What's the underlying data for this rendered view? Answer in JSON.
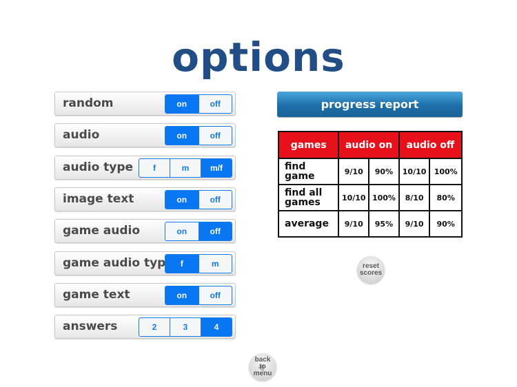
{
  "title": "options",
  "options": [
    {
      "label": "random",
      "choices": [
        "on",
        "off"
      ],
      "selected": "on"
    },
    {
      "label": "audio",
      "choices": [
        "on",
        "off"
      ],
      "selected": "on"
    },
    {
      "label": "audio type",
      "choices": [
        "f",
        "m",
        "m/f"
      ],
      "selected": "m/f"
    },
    {
      "label": "image text",
      "choices": [
        "on",
        "off"
      ],
      "selected": "on"
    },
    {
      "label": "game audio",
      "choices": [
        "on",
        "off"
      ],
      "selected": "off"
    },
    {
      "label": "game audio type",
      "choices": [
        "f",
        "m"
      ],
      "selected": "f"
    },
    {
      "label": "game text",
      "choices": [
        "on",
        "off"
      ],
      "selected": "on"
    },
    {
      "label": "answers",
      "choices": [
        "2",
        "3",
        "4"
      ],
      "selected": "4"
    }
  ],
  "progress_report": {
    "button_label": "progress report",
    "headers": [
      "games",
      "audio on",
      "audio off"
    ],
    "rows": [
      {
        "label": "find game",
        "audio_on_score": "9/10",
        "audio_on_pct": "90%",
        "audio_off_score": "10/10",
        "audio_off_pct": "100%"
      },
      {
        "label": "find  all games",
        "audio_on_score": "10/10",
        "audio_on_pct": "100%",
        "audio_off_score": "8/10",
        "audio_off_pct": "80%"
      },
      {
        "label": "average",
        "audio_on_score": "9/10",
        "audio_on_pct": "95%",
        "audio_off_score": "9/10",
        "audio_off_pct": "90%"
      }
    ]
  },
  "reset_button": {
    "line1": "reset",
    "line2": "scores"
  },
  "back_button": {
    "line1": "back",
    "line2": "to",
    "line3": "menu"
  },
  "colors": {
    "accent_blue": "#0a77f2",
    "title_blue": "#234d85",
    "table_header_red": "#e8101a"
  }
}
